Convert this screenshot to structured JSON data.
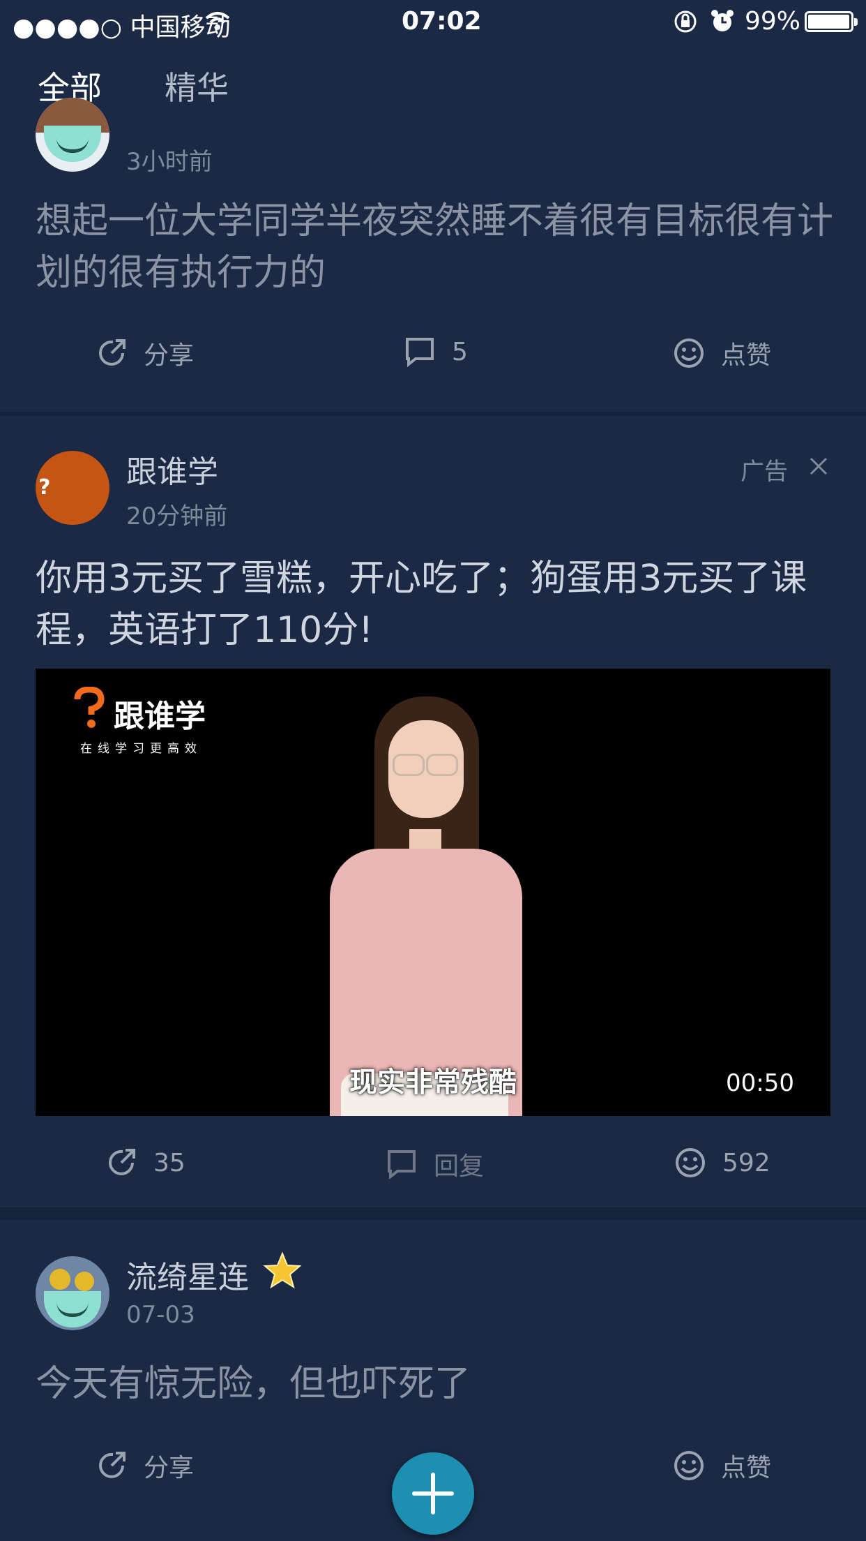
{
  "status_bar": {
    "carrier": "●●●●○ 中国移动",
    "time": "07:02",
    "battery_pct": "99%"
  },
  "tabs": [
    {
      "label": "全部"
    },
    {
      "label": "精华"
    }
  ],
  "posts": [
    {
      "time": "3小时前",
      "text": "想起一位大学同学半夜突然睡不着很有目标很有计划的很有执行力的",
      "share": "分享",
      "comments": "5",
      "like": "点赞"
    },
    {
      "name": "跟谁学",
      "time": "20分钟前",
      "ad_label": "广告",
      "text": "你用3元买了雪糕，开心吃了；狗蛋用3元买了课程，英语打了110分!",
      "video": {
        "brand": "跟谁学",
        "tagline": "在线学习更高效",
        "subtitle": "现实非常残酷",
        "duration": "00:50"
      },
      "share": "35",
      "reply": "回复",
      "likes": "592"
    },
    {
      "name": "流绮星连",
      "time": "07-03",
      "text": "今天有惊无险，但也吓死了",
      "share": "分享",
      "like": "点赞"
    }
  ]
}
